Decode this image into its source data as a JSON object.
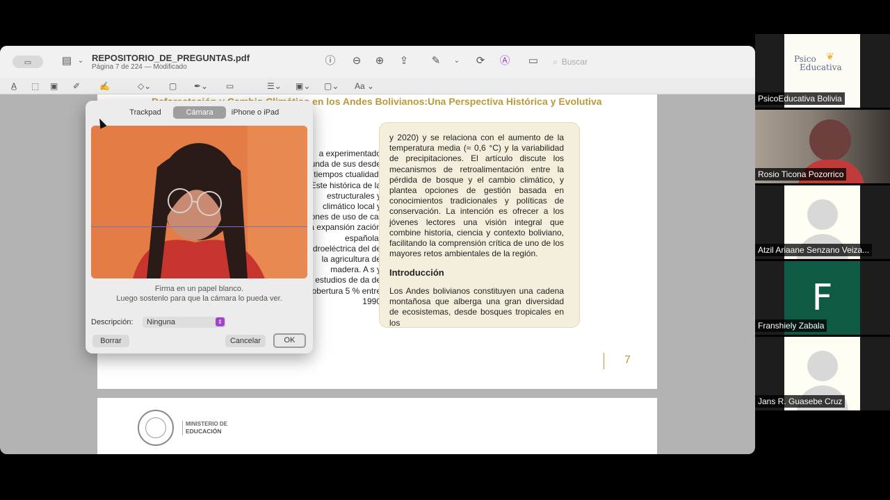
{
  "window": {
    "title": "REPOSITORIO_DE_PREGUNTAS.pdf",
    "subtitle": "Página 7 de 224 — Modificado",
    "search_placeholder": "Buscar"
  },
  "toolbar2": {
    "text_style_label": "Aa"
  },
  "page": {
    "heading": "Deforestación y Cambio Climático en los Andes Bolivianos:Una Perspectiva Histórica y Evolutiva",
    "left_col_text": "a experimentado unda de sus desde tiempos ctualidad. Este histórica de la estructurales y climático local y rones de uso de ca, la expansión zación española, idroeléctrica del de la agricultura de madera. A s y estudios de da de cobertura 5 % entre 1990",
    "right_col_text": "y 2020) y se relaciona con el aumento de la temperatura media (≈ 0,6 °C) y la variabilidad de precipitaciones. El artículo discute los mecanismos de retroalimentación entre la pérdida de bosque y el cambio climático, y plantea opciones de gestión basada en conocimientos tradicionales y políticas de conservación. La intención es ofrecer a los jóvenes lectores una visión integral que combine historia, ciencia y contexto boliviano, facilitando la comprensión crítica de uno de los mayores retos ambientales de la región.",
    "section_heading": "Introducción",
    "intro_text": "Los Andes bolivianos constituyen una cadena montañosa que alberga una gran diversidad de ecosistemas, desde bosques tropicales en los",
    "page_number": "7"
  },
  "page2": {
    "ministry_line1": "MINISTERIO DE",
    "ministry_line2": "EDUCACIÓN"
  },
  "dialog": {
    "tabs": [
      {
        "label": "Trackpad",
        "active": false
      },
      {
        "label": "Cámara",
        "active": true
      },
      {
        "label": "iPhone o iPad",
        "active": false
      }
    ],
    "hint_line1": "Firma en un papel blanco.",
    "hint_line2": "Luego sostenlo para que la cámara lo pueda ver.",
    "description_label": "Descripción:",
    "description_value": "Ninguna",
    "clear_label": "Borrar",
    "cancel_label": "Cancelar",
    "ok_label": "OK"
  },
  "participants": [
    {
      "name": "PsicoEducativa Bolivia",
      "logo_text1": "Psico",
      "logo_text2": "Educativa"
    },
    {
      "name": "Rosio Ticona Pozorrico"
    },
    {
      "name": "Atzil Ariaane Senzano Veiza..."
    },
    {
      "name": "Franshiely Zabala",
      "initial": "F"
    },
    {
      "name": "Jans R. Guasebe Cruz"
    }
  ],
  "colors": {
    "accent_gold": "#b89a3a",
    "box_beige": "#f4efdc",
    "avatar_green": "#0e5a44",
    "select_arrow": "#a044c8"
  }
}
